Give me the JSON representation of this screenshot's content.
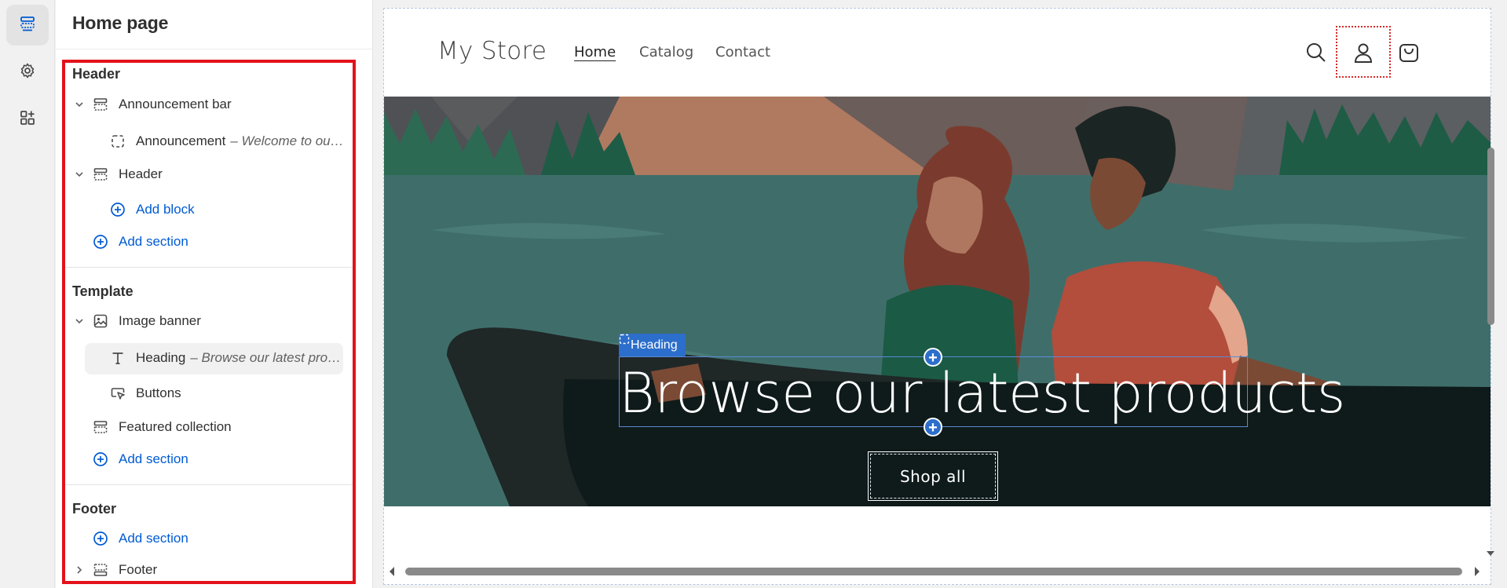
{
  "panel": {
    "title": "Home page",
    "groups": {
      "header": "Header",
      "template": "Template",
      "footer": "Footer"
    },
    "items": {
      "announcement_bar": "Announcement bar",
      "announcement": "Announcement",
      "announcement_sub": "– Welcome to ou…",
      "header": "Header",
      "add_block": "Add block",
      "add_section_1": "Add section",
      "image_banner": "Image banner",
      "heading": "Heading",
      "heading_sub": "– Browse our latest pro…",
      "buttons": "Buttons",
      "featured_collection": "Featured collection",
      "add_section_2": "Add section",
      "add_section_3": "Add section",
      "footer": "Footer"
    }
  },
  "preview": {
    "brand": "My Store",
    "nav": [
      "Home",
      "Catalog",
      "Contact"
    ],
    "heading_tag": "Heading",
    "hero_title": "Browse our latest products",
    "shop_button": "Shop all"
  },
  "icons": [
    "sections-icon",
    "settings-gear-icon",
    "apps-icon",
    "chevron-down-icon",
    "chevron-right-icon",
    "section-icon",
    "block-icon",
    "add-circle-icon",
    "image-icon",
    "text-icon",
    "cursor-button-icon",
    "search-icon",
    "account-icon",
    "cart-icon"
  ],
  "colors": {
    "accent": "#005bd3",
    "highlight": "#e3121b",
    "tag": "#2c6ecb"
  }
}
